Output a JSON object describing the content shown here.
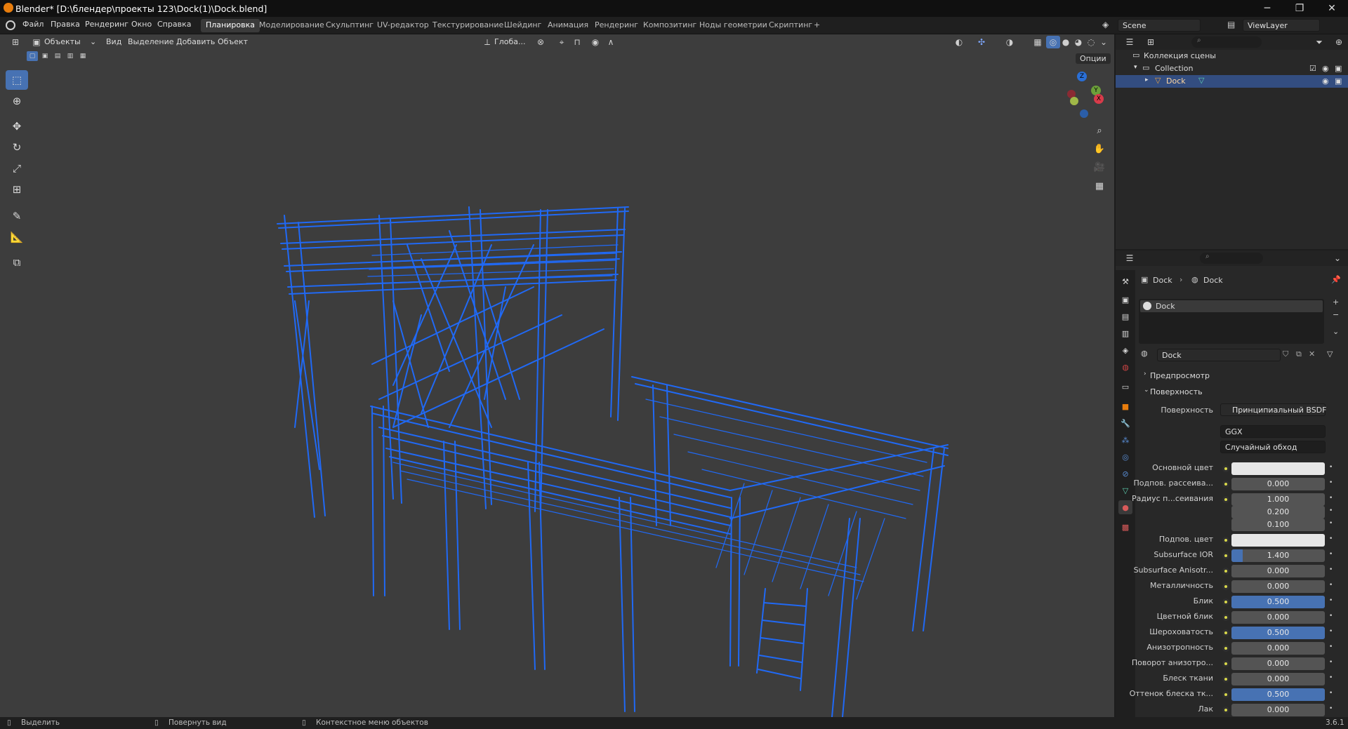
{
  "window": {
    "title": "Blender* [D:\\блендер\\проекты 123\\Dock(1)\\Dock.blend]",
    "minimize": "─",
    "restore": "❐",
    "close": "✕"
  },
  "menu": [
    "Файл",
    "Правка",
    "Рендеринг",
    "Окно",
    "Справка"
  ],
  "workspaces": [
    {
      "label": "Планировка",
      "active": true
    },
    {
      "label": "Моделирование"
    },
    {
      "label": "Скульптинг"
    },
    {
      "label": "UV-редактор"
    },
    {
      "label": "Текстурирование"
    },
    {
      "label": "Шейдинг"
    },
    {
      "label": "Анимация"
    },
    {
      "label": "Рендеринг"
    },
    {
      "label": "Композитинг"
    },
    {
      "label": "Ноды геометрии"
    },
    {
      "label": "Скриптинг"
    },
    {
      "label": "+"
    }
  ],
  "scene": {
    "name": "Scene",
    "view_layer": "ViewLayer"
  },
  "viewport_header": {
    "mode": "Объекты",
    "menus": [
      "Вид",
      "Выделение",
      "Добавить",
      "Объект"
    ],
    "orientation": "Глоба...",
    "options": "Опции"
  },
  "gizmo": {
    "z": "Z",
    "x": "X",
    "y": "Y"
  },
  "outliner": {
    "root": "Коллекция сцены",
    "collection": "Collection",
    "object": "Dock"
  },
  "properties": {
    "breadcrumb": [
      "Dock",
      "Dock"
    ],
    "material_slot": "Dock",
    "material_name": "Dock",
    "sections": {
      "preview": "Предпросмотр",
      "surface": "Поверхность"
    },
    "surface_shader_label": "Поверхность",
    "surface_shader": "Принципиальный BSDF",
    "distribution": "GGX",
    "subsurface_method": "Случайный обход",
    "rows": [
      {
        "label": "Основной цвет",
        "value": "",
        "type": "color"
      },
      {
        "label": "Подпов. рассеива...",
        "value": "0.000"
      },
      {
        "label": "Радиус п...сеивания",
        "value": "1.000"
      },
      {
        "label": "",
        "value": "0.200"
      },
      {
        "label": "",
        "value": "0.100"
      },
      {
        "label": "Подпов. цвет",
        "value": "",
        "type": "color"
      },
      {
        "label": "Subsurface IOR",
        "value": "1.400",
        "fill": 0.12
      },
      {
        "label": "Subsurface Anisotr...",
        "value": "0.000"
      },
      {
        "label": "Металличность",
        "value": "0.000"
      },
      {
        "label": "Блик",
        "value": "0.500",
        "fill": 1.0
      },
      {
        "label": "Цветной блик",
        "value": "0.000"
      },
      {
        "label": "Шероховатость",
        "value": "0.500",
        "fill": 1.0
      },
      {
        "label": "Анизотропность",
        "value": "0.000"
      },
      {
        "label": "Поворот анизотро...",
        "value": "0.000"
      },
      {
        "label": "Блеск ткани",
        "value": "0.000"
      },
      {
        "label": "Оттенок блеска тк...",
        "value": "0.500",
        "fill": 1.0
      },
      {
        "label": "Лак",
        "value": "0.000"
      }
    ]
  },
  "statusbar": {
    "select": "Выделить",
    "rotate": "Повернуть вид",
    "context": "Контекстное меню объектов",
    "version": "3.6.1"
  },
  "colors": {
    "accent": "#4772b3",
    "wire": "#1f6cff",
    "viewport_bg": "#3d3d3d"
  }
}
